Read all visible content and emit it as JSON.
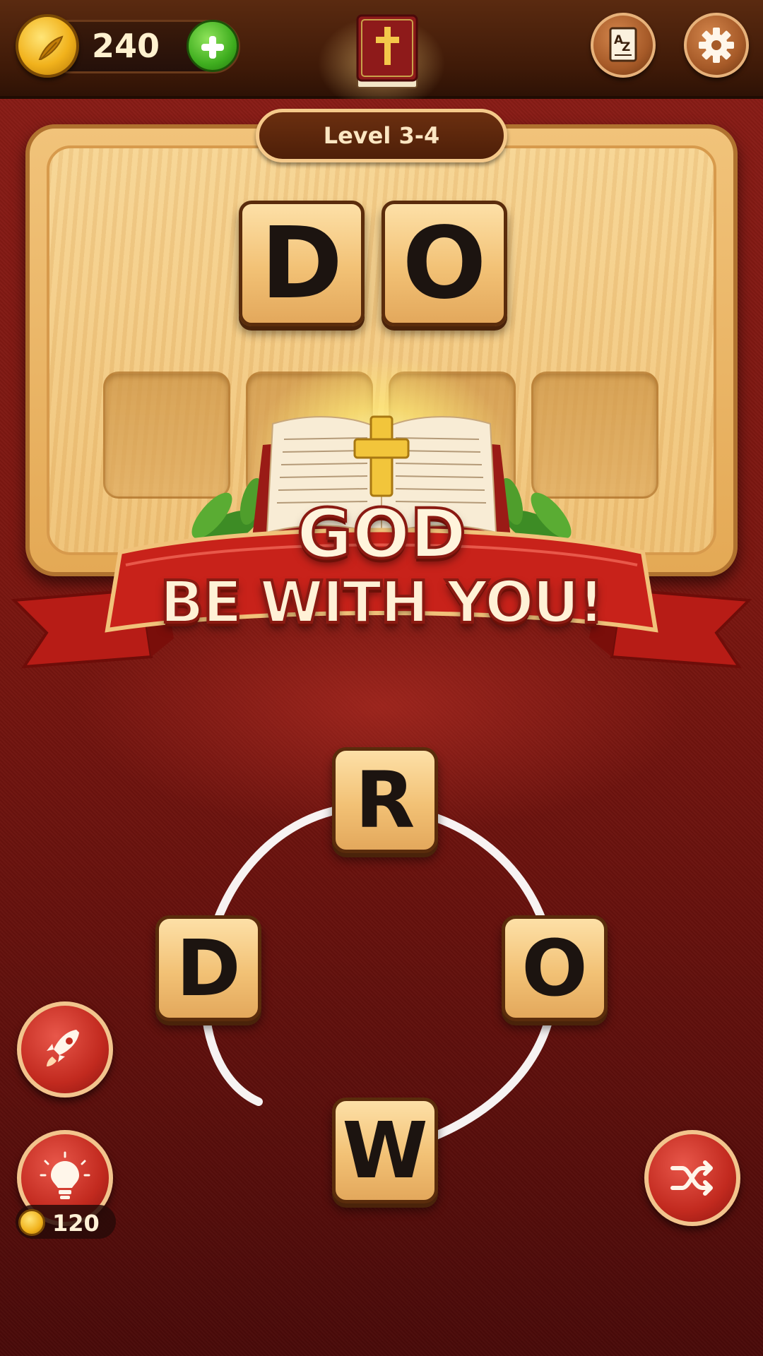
{
  "header": {
    "coins": "240",
    "icons": [
      "coin-icon",
      "plus-icon",
      "bible-icon",
      "az-dictionary-icon",
      "gear-icon"
    ]
  },
  "board": {
    "level_label": "Level 3-4",
    "found_word": [
      "D",
      "O"
    ],
    "empty_slots": 4
  },
  "banner": {
    "line1": "GOD",
    "line2": "BE WITH YOU!"
  },
  "wheel": {
    "letters": {
      "top": "R",
      "left": "D",
      "right": "O",
      "bottom": "W"
    }
  },
  "powerups": {
    "rocket_icon": "rocket-icon",
    "hint_icon": "lightbulb-icon",
    "hint_cost": "120",
    "shuffle_icon": "shuffle-icon"
  },
  "colors": {
    "background": "#7a1610",
    "wood": "#f2c175",
    "topbar": "#3f1a08",
    "banner_red": "#c8221a",
    "coin_gold": "#f1b21c",
    "plus_green": "#3fae1f"
  }
}
